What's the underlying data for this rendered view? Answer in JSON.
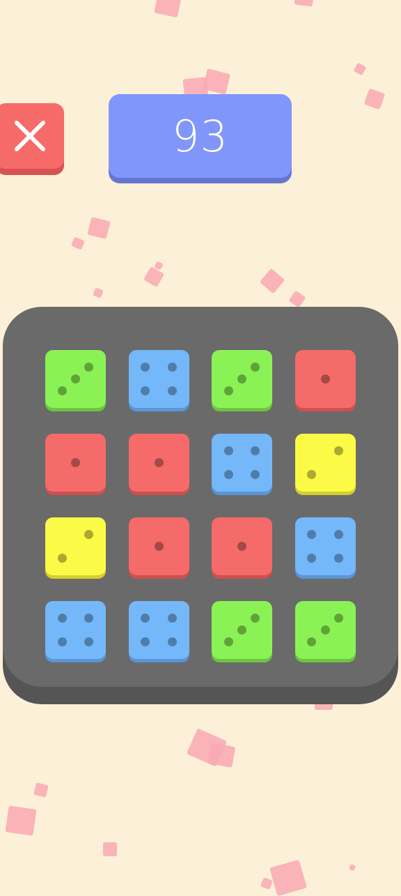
{
  "header": {
    "close_icon": "close-x-icon",
    "score": "93"
  },
  "colors": {
    "background": "#fcf0d8",
    "board": "#6a6a6a",
    "close_button": "#f76a6a",
    "score_box": "#8196fa",
    "green": "#8bf255",
    "blue": "#75b8f9",
    "red": "#f56b69",
    "yellow": "#fbfb47"
  },
  "board": {
    "rows": 4,
    "cols": 4,
    "dice": [
      {
        "color": "green",
        "value": 3
      },
      {
        "color": "blue",
        "value": 4
      },
      {
        "color": "green",
        "value": 3
      },
      {
        "color": "red",
        "value": 1
      },
      {
        "color": "red",
        "value": 1
      },
      {
        "color": "red",
        "value": 1
      },
      {
        "color": "blue",
        "value": 4
      },
      {
        "color": "yellow",
        "value": 2
      },
      {
        "color": "yellow",
        "value": 2
      },
      {
        "color": "red",
        "value": 1
      },
      {
        "color": "red",
        "value": 1
      },
      {
        "color": "blue",
        "value": 4
      },
      {
        "color": "blue",
        "value": 4
      },
      {
        "color": "blue",
        "value": 4
      },
      {
        "color": "green",
        "value": 3
      },
      {
        "color": "green",
        "value": 3
      }
    ]
  }
}
